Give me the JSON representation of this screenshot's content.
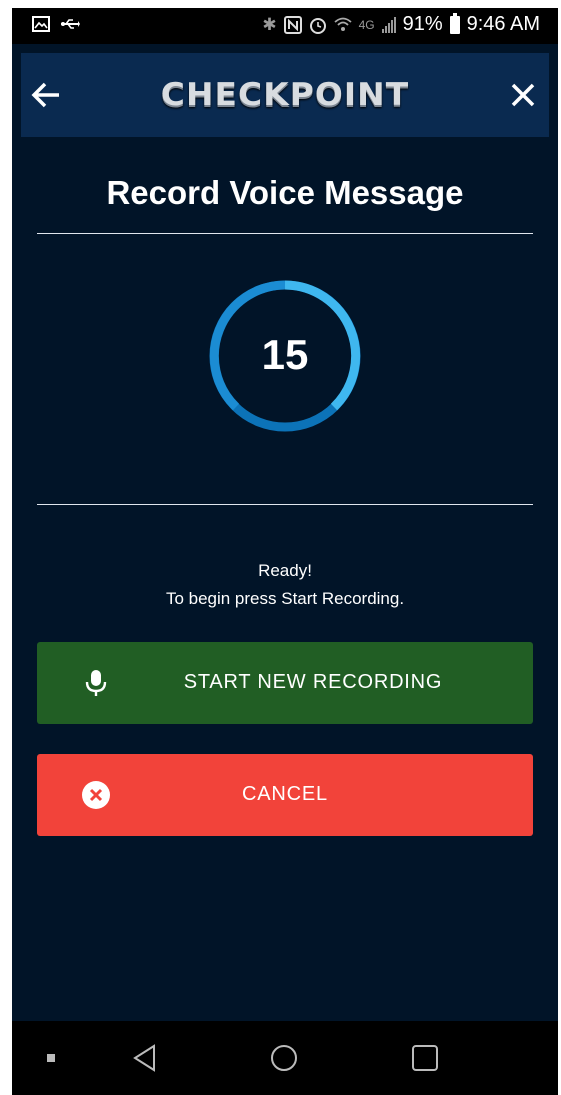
{
  "status_bar": {
    "battery_percent": "91%",
    "time": "9:46 AM",
    "network": "4G",
    "icons": [
      "gallery-icon",
      "usb-icon",
      "bluetooth-icon",
      "nfc-icon",
      "alarm-icon",
      "wifi-icon",
      "signal-icon",
      "battery-icon"
    ]
  },
  "header": {
    "logo_text": "CHECKPOINT",
    "back_icon": "back-arrow-icon",
    "close_icon": "close-icon"
  },
  "page": {
    "title": "Record Voice Message"
  },
  "timer": {
    "value": "15",
    "ring_color": "#2ea8e6"
  },
  "status": {
    "line1": "Ready!",
    "line2": "To begin press Start Recording."
  },
  "buttons": {
    "start_label": "START NEW RECORDING",
    "start_icon": "microphone-icon",
    "start_color": "#215e24",
    "cancel_label": "CANCEL",
    "cancel_icon": "cancel-circle-icon",
    "cancel_color": "#f2433a"
  },
  "nav_bar": {
    "items": [
      "recent-apps-icon",
      "back-icon",
      "home-icon",
      "overview-icon"
    ]
  }
}
